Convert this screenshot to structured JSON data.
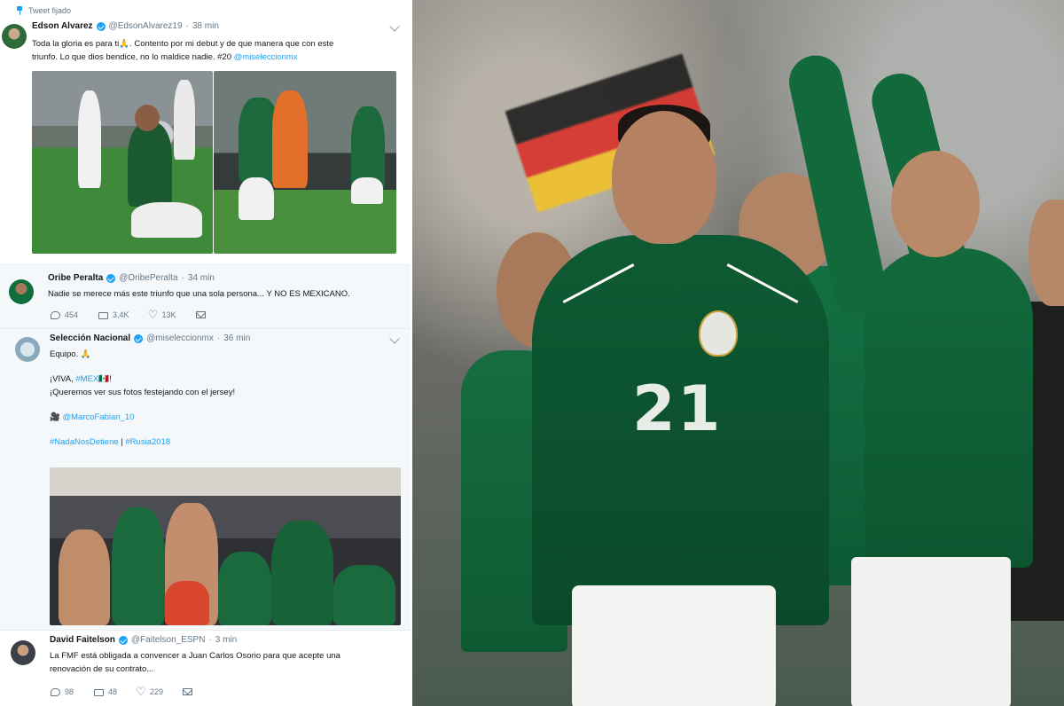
{
  "tweets": [
    {
      "pinned_label": "Tweet fijado",
      "name": "Edson Alvarez",
      "handle": "@EdsonAlvarez19",
      "time": "38 min",
      "line1": "Toda la gloria es para ti🙏. Contento por mi debut y de que manera que con este",
      "line2_a": "triunfo. Lo que dios bendice, no lo maldice nadie. #20 ",
      "line2_link": "@miseleccionmx"
    },
    {
      "name": "Oribe Peralta",
      "handle": "@OribePeralta",
      "time": "34 min",
      "line1": "Nadie se merece más este triunfo que una sola persona... Y NO ES MEXICANO.",
      "replies": "454",
      "retweets": "3,4K",
      "likes": "13K"
    },
    {
      "name": "Selección Nacional",
      "handle": "@miseleccionmx",
      "time": "36 min",
      "line1": "Equipo. 🙏",
      "line2_a": "¡VIVA, ",
      "line2_link": "#MEX",
      "line2_b": "🇲🇽!",
      "line3": "¡Queremos ver sus fotos festejando con el jersey!",
      "line4_link": "@MarcoFabian_10",
      "line5_link1": "#NadaNosDetiene",
      "line5_sep": " | ",
      "line5_link2": "#Rusia2018"
    },
    {
      "name": "David Faitelson",
      "handle": "@Faitelson_ESPN",
      "time": "3 min",
      "line1": "La FMF está obligada a convencer a Juan Carlos Osorio para que acepte una",
      "line2": "renovación de su contrato...",
      "replies": "98",
      "retweets": "48",
      "likes": "229"
    }
  ],
  "photo": {
    "jersey_number": "21"
  },
  "colors": {
    "link": "#1da1f2",
    "muted": "#657786",
    "jersey_green": "#0e5a33"
  }
}
